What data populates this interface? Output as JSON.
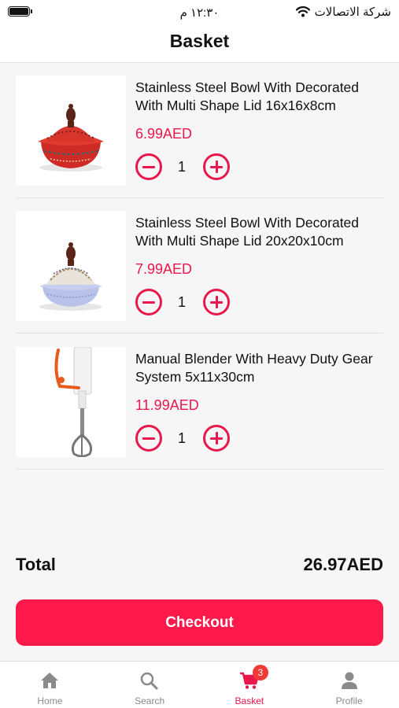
{
  "status_bar": {
    "time": "١٢:٣٠ م",
    "carrier": "شركة الاتصالات"
  },
  "header": {
    "title": "Basket"
  },
  "items": [
    {
      "name": "Stainless Steel Bowl With Decorated With Multi Shape Lid 16x16x8cm",
      "price": "6.99AED",
      "quantity": "1",
      "image_icon": "red-decorated-bowl-image"
    },
    {
      "name": "Stainless Steel Bowl With Decorated With Multi Shape Lid 20x20x10cm",
      "price": "7.99AED",
      "quantity": "1",
      "image_icon": "blue-decorated-bowl-image"
    },
    {
      "name": "Manual Blender With Heavy Duty Gear System 5x11x30cm",
      "price": "11.99AED",
      "quantity": "1",
      "image_icon": "manual-blender-image"
    }
  ],
  "summary": {
    "total_label": "Total",
    "total_value": "26.97AED"
  },
  "checkout": {
    "label": "Checkout"
  },
  "tab_bar": {
    "tabs": [
      {
        "label": "Home",
        "icon": "home-icon"
      },
      {
        "label": "Search",
        "icon": "search-icon"
      },
      {
        "label": "Basket",
        "icon": "cart-icon",
        "badge": "3"
      },
      {
        "label": "Profile",
        "icon": "person-icon"
      }
    ],
    "active": "Basket"
  },
  "colors": {
    "accent": "#e8174c",
    "button": "#ff1a4b",
    "badge": "#f23a35",
    "inactive": "#8a8a8a"
  }
}
